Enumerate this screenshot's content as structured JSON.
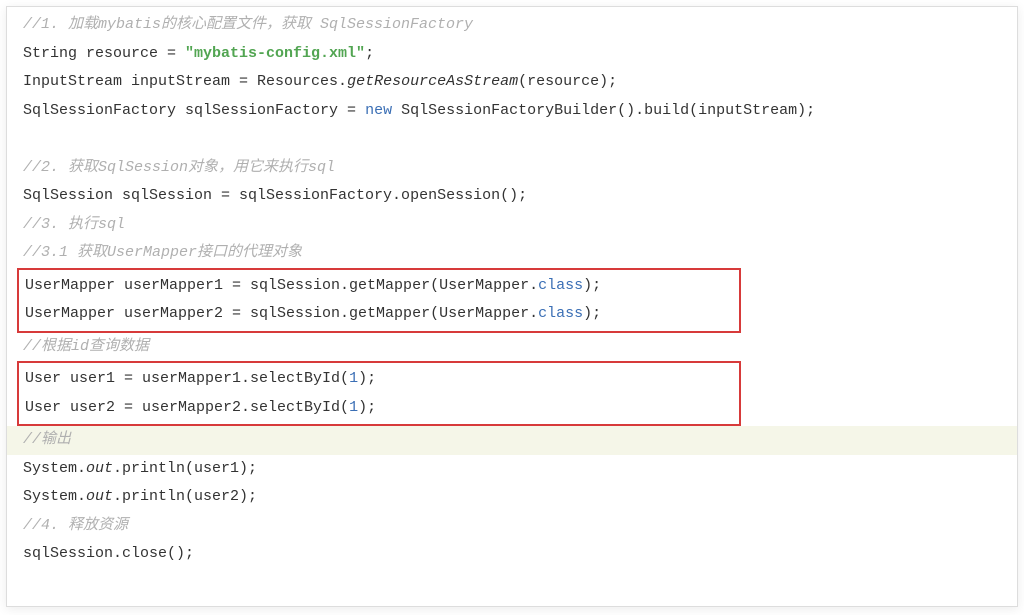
{
  "code": {
    "comment1": "//1. 加载mybatis的核心配置文件，获取 SqlSessionFactory",
    "l2a": "String resource = ",
    "l2str": "\"mybatis-config.xml\"",
    "l2b": ";",
    "l3a": "InputStream inputStream = Resources.",
    "l3b": "getResourceAsStream",
    "l3c": "(resource);",
    "l4a": "SqlSessionFactory sqlSessionFactory = ",
    "l4kw": "new",
    "l4b": " SqlSessionFactoryBuilder().build(inputStream);",
    "comment2": "//2. 获取SqlSession对象，用它来执行sql",
    "l6": "SqlSession sqlSession = sqlSessionFactory.openSession();",
    "comment3": "//3. 执行sql",
    "comment31": "//3.1 获取UserMapper接口的代理对象",
    "l8a": "UserMapper userMapper1 = sqlSession.getMapper(UserMapper.",
    "l8kw": "class",
    "l8b": ");",
    "l9a": "UserMapper userMapper2 = sqlSession.getMapper(UserMapper.",
    "l9kw": "class",
    "l9b": ");",
    "comment_id": "//根据id查询数据",
    "l10a": "User user1 = userMapper1.selectById(",
    "l10n": "1",
    "l10b": ");",
    "l11a": "User user2 = userMapper2.selectById(",
    "l11n": "1",
    "l11b": ");",
    "comment_out": "//输出",
    "l12a": "System.",
    "l12b": "out",
    "l12c": ".println(user1);",
    "l13a": "System.",
    "l13b": "out",
    "l13c": ".println(user2);",
    "comment4": "//4. 释放资源",
    "l14": "sqlSession.close();"
  }
}
